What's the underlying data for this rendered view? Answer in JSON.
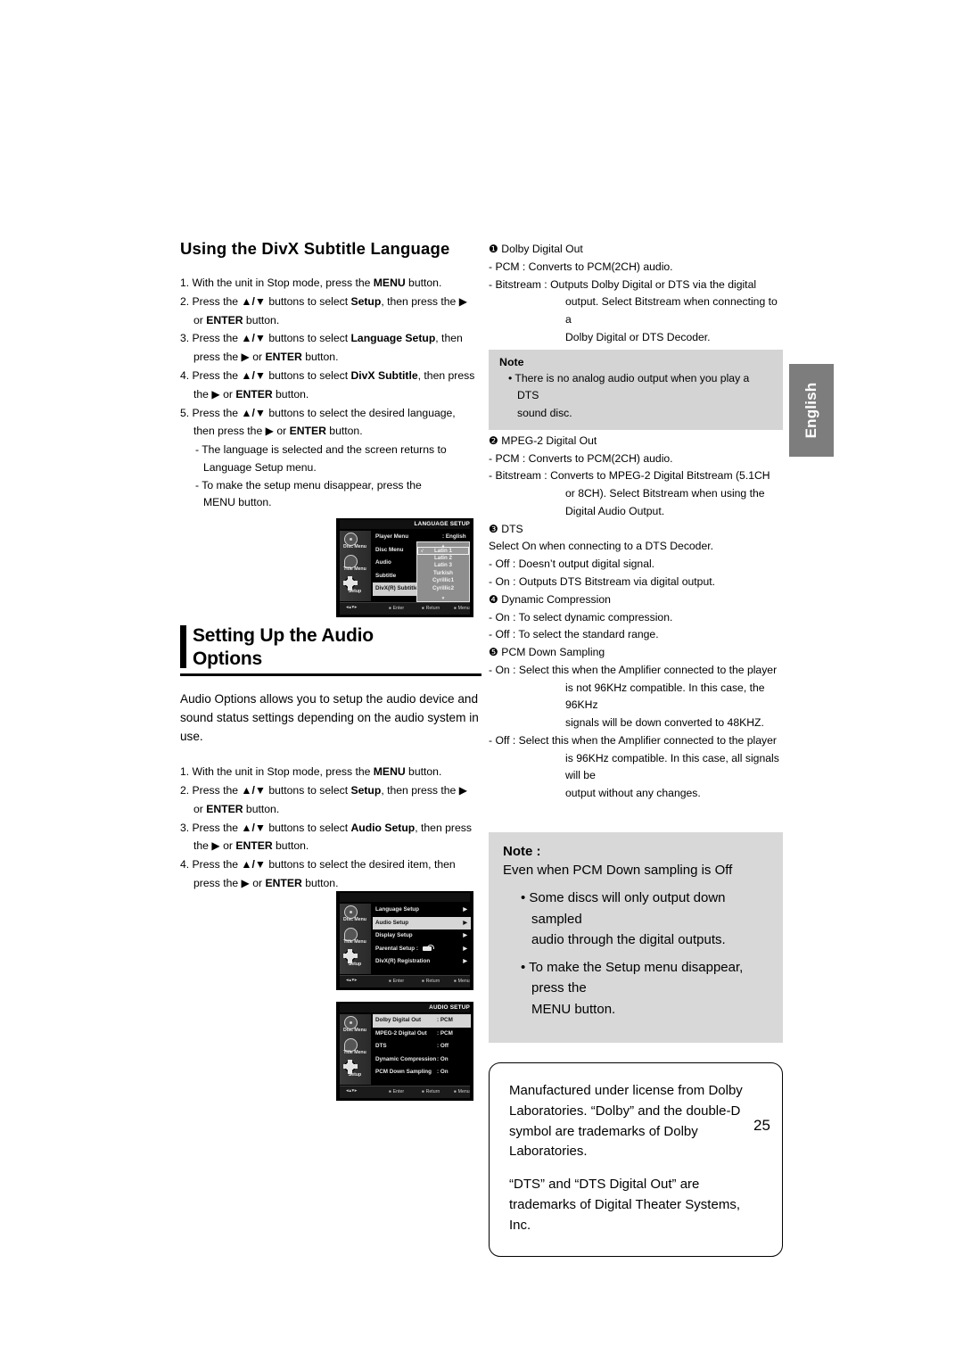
{
  "page": {
    "number": "25",
    "side_tab": "English"
  },
  "left_column": {
    "heading1": "Using the DivX Subtitle Language",
    "steps1": [
      {
        "num": "1.",
        "parts": [
          {
            "t": "With the unit in Stop mode, press the "
          },
          {
            "t": "MENU",
            "b": true
          },
          {
            "t": " button."
          }
        ]
      },
      {
        "num": "2.",
        "parts": [
          {
            "t": "Press the "
          },
          {
            "t": "▲/▼",
            "b": true
          },
          {
            "t": " buttons to select "
          },
          {
            "t": "Setup",
            "b": true
          },
          {
            "t": ", then press the ▶"
          }
        ]
      },
      {
        "num": "",
        "parts": [
          {
            "t": "or "
          },
          {
            "t": "ENTER",
            "b": true
          },
          {
            "t": " button."
          }
        ]
      },
      {
        "num": "3.",
        "parts": [
          {
            "t": "Press the "
          },
          {
            "t": "▲/▼",
            "b": true
          },
          {
            "t": " buttons to select "
          },
          {
            "t": "Language Setup",
            "b": true
          },
          {
            "t": ", then"
          }
        ]
      },
      {
        "num": "",
        "parts": [
          {
            "t": "press the ▶ or "
          },
          {
            "t": "ENTER",
            "b": true
          },
          {
            "t": " button."
          }
        ]
      },
      {
        "num": "4.",
        "parts": [
          {
            "t": "Press the "
          },
          {
            "t": "▲/▼",
            "b": true
          },
          {
            "t": " buttons to select "
          },
          {
            "t": "DivX Subtitle",
            "b": true
          },
          {
            "t": ", then press"
          }
        ]
      },
      {
        "num": "",
        "parts": [
          {
            "t": "the ▶  or "
          },
          {
            "t": "ENTER",
            "b": true
          },
          {
            "t": " button."
          }
        ]
      },
      {
        "num": "5.",
        "parts": [
          {
            "t": "Press the "
          },
          {
            "t": "▲/▼",
            "b": true
          },
          {
            "t": " buttons to select the desired  language,"
          }
        ]
      },
      {
        "num": "",
        "parts": [
          {
            "t": "then press the ▶ or "
          },
          {
            "t": "ENTER",
            "b": true
          },
          {
            "t": " button."
          }
        ]
      }
    ],
    "dashes1": [
      "- The language is selected and the screen returns to",
      "Language Setup menu.",
      "- To make the setup menu disappear, press the",
      "MENU button."
    ],
    "heading2_line1": "Setting Up the Audio",
    "heading2_line2": "Options",
    "intro2": "Audio Options allows you to setup the audio device and sound status settings depending on the audio system in use.",
    "steps2": [
      {
        "num": "1.",
        "parts": [
          {
            "t": "With the unit in Stop mode, press the "
          },
          {
            "t": "MENU",
            "b": true
          },
          {
            "t": " button."
          }
        ]
      },
      {
        "num": "2.",
        "parts": [
          {
            "t": "Press the "
          },
          {
            "t": "▲/▼",
            "b": true
          },
          {
            "t": " buttons to select "
          },
          {
            "t": "Setup",
            "b": true
          },
          {
            "t": ", then press the ▶"
          }
        ]
      },
      {
        "num": "",
        "parts": [
          {
            "t": "or "
          },
          {
            "t": "ENTER",
            "b": true
          },
          {
            "t": " button."
          }
        ]
      },
      {
        "num": "3.",
        "parts": [
          {
            "t": "Press the "
          },
          {
            "t": "▲/▼",
            "b": true
          },
          {
            "t": " buttons to select "
          },
          {
            "t": "Audio Setup",
            "b": true
          },
          {
            "t": ", then press"
          }
        ]
      },
      {
        "num": "",
        "parts": [
          {
            "t": "the ▶ or "
          },
          {
            "t": "ENTER",
            "b": true
          },
          {
            "t": " button."
          }
        ]
      },
      {
        "num": "4.",
        "parts": [
          {
            "t": "Press the "
          },
          {
            "t": "▲/▼",
            "b": true
          },
          {
            "t": " buttons to select the desired item, then"
          }
        ]
      },
      {
        "num": "",
        "parts": [
          {
            "t": "press the ▶ or "
          },
          {
            "t": "ENTER",
            "b": true
          },
          {
            "t": " button."
          }
        ]
      }
    ]
  },
  "right_column": {
    "item1_title": "❶ Dolby Digital Out",
    "item1_lines": [
      {
        "text": "- PCM : Converts to PCM(2CH) audio.",
        "indent": false
      },
      {
        "text": "- Bitstream : Outputs Dolby Digital or DTS via the digital",
        "indent": false
      },
      {
        "text": "output. Select Bitstream when connecting to a",
        "indent": true
      },
      {
        "text": "Dolby Digital or DTS Decoder.",
        "indent": true
      }
    ],
    "note1": {
      "title": "Note",
      "lines": [
        "• There is no analog audio output when you play a DTS",
        "sound disc."
      ]
    },
    "item2_title": "❷ MPEG-2 Digital Out",
    "item2_lines": [
      {
        "text": "- PCM : Converts to PCM(2CH) audio.",
        "indent": false
      },
      {
        "text": "- Bitstream : Converts to MPEG-2 Digital Bitstream (5.1CH",
        "indent": false
      },
      {
        "text": "or 8CH). Select Bitstream when using the",
        "indent": true
      },
      {
        "text": "Digital Audio Output.",
        "indent": true
      }
    ],
    "item3_title": "❸ DTS",
    "item3_lines": [
      {
        "text": "Select On when connecting to a DTS Decoder.",
        "indent": false
      },
      {
        "text": "- Off : Doesn’t output digital signal.",
        "indent": false
      },
      {
        "text": "- On : Outputs DTS Bitstream via digital output.",
        "indent": false
      }
    ],
    "item4_title": "❹ Dynamic Compression",
    "item4_lines": [
      {
        "text": "- On : To select dynamic compression.",
        "indent": false
      },
      {
        "text": "- Off : To select the standard range.",
        "indent": false
      }
    ],
    "item5_title": "❺ PCM Down Sampling",
    "item5_lines": [
      {
        "text": "- On : Select this when the Amplifier connected to the player",
        "indent": false
      },
      {
        "text": "is not 96KHz compatible. In this case, the 96KHz",
        "indent": true
      },
      {
        "text": "signals will be down converted to 48KHZ.",
        "indent": true
      },
      {
        "text": "- Off : Select this when the Amplifier connected to the player",
        "indent": false
      },
      {
        "text": "is 96KHz compatible. In this case, all signals will be",
        "indent": true
      },
      {
        "text": "output without any changes.",
        "indent": true
      }
    ],
    "note2": {
      "title": "Note :",
      "line1": "Even when PCM Down sampling is Off",
      "bullet1_a": "• Some discs will only output down sampled",
      "bullet1_b": "audio through the digital outputs.",
      "bullet2_a": "• To make the Setup menu disappear, press the",
      "bullet2_b": "MENU button."
    },
    "trademark": {
      "p1": "Manufactured under license from Dolby Laboratories. “Dolby” and the double-D symbol are trademarks of Dolby Laboratories.",
      "p2": "“DTS” and “DTS Digital Out” are trademarks of Digital Theater Systems, Inc."
    }
  },
  "osd_language_setup": {
    "title": "LANGUAGE SETUP",
    "rail": [
      {
        "label": "Disc Menu",
        "icon": "disc-menu-icon",
        "selected": false
      },
      {
        "label": "Title Menu",
        "icon": "title-menu-icon",
        "selected": false
      },
      {
        "label": "Setup",
        "icon": "gear-icon",
        "selected": false
      }
    ],
    "rows": [
      {
        "label": "Player Menu",
        "value": ": English",
        "highlight": false
      },
      {
        "label": "Disc Menu",
        "value": "",
        "highlight": false
      },
      {
        "label": "Audio",
        "value": "",
        "highlight": false
      },
      {
        "label": "Subtitle",
        "value": "",
        "highlight": false
      },
      {
        "label": "DivX(R) Subtitle",
        "value": "",
        "highlight": true
      }
    ],
    "dropdown": {
      "up": "▲",
      "down": "▼",
      "check": "√",
      "items": [
        "Latin 1",
        "Latin 2",
        "Latin 3",
        "Turkish",
        "Cyrillic1",
        "Cyrillic2"
      ]
    },
    "footer": {
      "pad": "◂▴▾▸",
      "enter": "Enter",
      "return": "Return",
      "menu": "Menu"
    }
  },
  "osd_setup_menu": {
    "title": "",
    "rail": [
      {
        "label": "Disc Menu",
        "icon": "disc-menu-icon",
        "selected": false
      },
      {
        "label": "Title Menu",
        "icon": "title-menu-icon",
        "selected": false
      },
      {
        "label": "Setup",
        "icon": "gear-icon",
        "selected": false
      }
    ],
    "rows": [
      {
        "label": "Language Setup",
        "value": "",
        "arrow": "▶",
        "highlight": false,
        "lock": false
      },
      {
        "label": "Audio Setup",
        "value": "",
        "arrow": "▶",
        "highlight": true,
        "lock": false
      },
      {
        "label": "Display Setup",
        "value": "",
        "arrow": "▶",
        "highlight": false,
        "lock": false
      },
      {
        "label": "Parental Setup :",
        "value": "",
        "arrow": "▶",
        "highlight": false,
        "lock": true
      },
      {
        "label": "DivX(R) Registration",
        "value": "",
        "arrow": "▶",
        "highlight": false,
        "lock": false
      }
    ],
    "footer": {
      "pad": "◂▴▾▸",
      "enter": "Enter",
      "return": "Return",
      "menu": "Menu"
    }
  },
  "osd_audio_setup": {
    "title": "AUDIO SETUP",
    "rail": [
      {
        "label": "Disc Menu",
        "icon": "disc-menu-icon",
        "selected": false
      },
      {
        "label": "Title Menu",
        "icon": "title-menu-icon",
        "selected": false
      },
      {
        "label": "Setup",
        "icon": "gear-icon",
        "selected": false
      }
    ],
    "rows": [
      {
        "label": "Dolby Digital Out",
        "value": ": PCM",
        "highlight": true
      },
      {
        "label": "MPEG-2 Digital Out",
        "value": ": PCM",
        "highlight": false
      },
      {
        "label": "DTS",
        "value": ": Off",
        "highlight": false
      },
      {
        "label": "Dynamic Compression",
        "value": ": On",
        "highlight": false
      },
      {
        "label": "PCM Down Sampling",
        "value": ": On",
        "highlight": false
      }
    ],
    "footer": {
      "pad": "◂▴▾▸",
      "enter": "Enter",
      "return": "Return",
      "menu": "Menu"
    }
  }
}
